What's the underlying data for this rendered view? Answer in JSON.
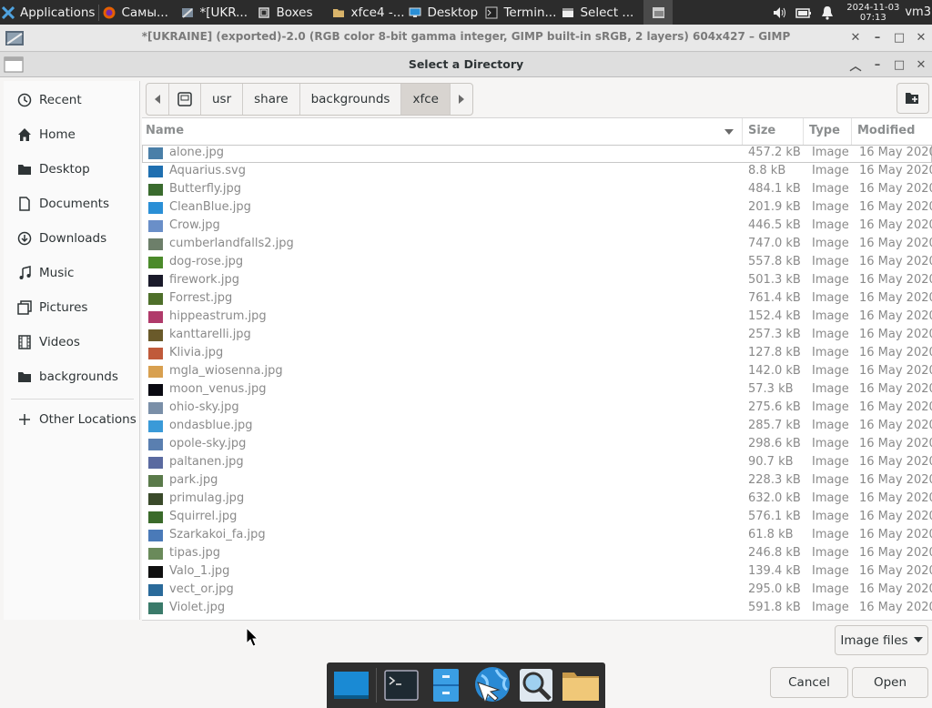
{
  "taskbar": {
    "apps_label": "Applications",
    "items": [
      {
        "label": "Самы...",
        "icon": "firefox-icon"
      },
      {
        "label": "*[UKR...",
        "icon": "gimp-icon"
      },
      {
        "label": "Boxes",
        "icon": "boxes-icon"
      },
      {
        "label": "xfce4 -...",
        "icon": "folder-icon"
      },
      {
        "label": "Desktop",
        "icon": "desktop-icon"
      },
      {
        "label": "Termin...",
        "icon": "terminal-icon"
      },
      {
        "label": "Select ...",
        "icon": "dialog-icon"
      }
    ],
    "clock_date": "2024-11-03",
    "clock_time": "07:13",
    "user": "vm3"
  },
  "gimp_window": {
    "title": "*[UKRAINE] (exported)-2.0 (RGB color 8-bit gamma integer, GIMP built-in sRGB, 2 layers) 604x427 – GIMP"
  },
  "dialog": {
    "title": "Select a Directory",
    "sidebar": [
      {
        "label": "Recent",
        "icon": "clock-icon"
      },
      {
        "label": "Home",
        "icon": "home-icon"
      },
      {
        "label": "Desktop",
        "icon": "folder-icon"
      },
      {
        "label": "Documents",
        "icon": "document-icon"
      },
      {
        "label": "Downloads",
        "icon": "download-icon"
      },
      {
        "label": "Music",
        "icon": "music-icon"
      },
      {
        "label": "Pictures",
        "icon": "pictures-icon"
      },
      {
        "label": "Videos",
        "icon": "video-icon"
      },
      {
        "label": "backgrounds",
        "icon": "folder-icon"
      },
      {
        "label": "Other Locations",
        "icon": "plus-icon"
      }
    ],
    "path": [
      "usr",
      "share",
      "backgrounds",
      "xfce"
    ],
    "columns": {
      "name": "Name",
      "size": "Size",
      "type": "Type",
      "modified": "Modified"
    },
    "files": [
      {
        "name": "alone.jpg",
        "size": "457.2 kB",
        "type": "Image",
        "modified": "16 May 2020",
        "thumb": "#4a7fa8"
      },
      {
        "name": "Aquarius.svg",
        "size": "8.8 kB",
        "type": "Image",
        "modified": "16 May 2020",
        "thumb": "#1f6fb0"
      },
      {
        "name": "Butterfly.jpg",
        "size": "484.1 kB",
        "type": "Image",
        "modified": "16 May 2020",
        "thumb": "#3a6b2e"
      },
      {
        "name": "CleanBlue.jpg",
        "size": "201.9 kB",
        "type": "Image",
        "modified": "16 May 2020",
        "thumb": "#2a8fd6"
      },
      {
        "name": "Crow.jpg",
        "size": "446.5 kB",
        "type": "Image",
        "modified": "16 May 2020",
        "thumb": "#6a8fc8"
      },
      {
        "name": "cumberlandfalls2.jpg",
        "size": "747.0 kB",
        "type": "Image",
        "modified": "16 May 2020",
        "thumb": "#6d7f6a"
      },
      {
        "name": "dog-rose.jpg",
        "size": "557.8 kB",
        "type": "Image",
        "modified": "16 May 2020",
        "thumb": "#4b8a2a"
      },
      {
        "name": "firework.jpg",
        "size": "501.3 kB",
        "type": "Image",
        "modified": "16 May 2020",
        "thumb": "#1a1a2a"
      },
      {
        "name": "Forrest.jpg",
        "size": "761.4 kB",
        "type": "Image",
        "modified": "16 May 2020",
        "thumb": "#4e6f2a"
      },
      {
        "name": "hippeastrum.jpg",
        "size": "152.4 kB",
        "type": "Image",
        "modified": "16 May 2020",
        "thumb": "#b03a6a"
      },
      {
        "name": "kanttarelli.jpg",
        "size": "257.3 kB",
        "type": "Image",
        "modified": "16 May 2020",
        "thumb": "#6a5a2a"
      },
      {
        "name": "Klivia.jpg",
        "size": "127.8 kB",
        "type": "Image",
        "modified": "16 May 2020",
        "thumb": "#c05a3a"
      },
      {
        "name": "mgla_wiosenna.jpg",
        "size": "142.0 kB",
        "type": "Image",
        "modified": "16 May 2020",
        "thumb": "#d8a050"
      },
      {
        "name": "moon_venus.jpg",
        "size": "57.3 kB",
        "type": "Image",
        "modified": "16 May 2020",
        "thumb": "#0a0a12"
      },
      {
        "name": "ohio-sky.jpg",
        "size": "275.6 kB",
        "type": "Image",
        "modified": "16 May 2020",
        "thumb": "#7a8fa8"
      },
      {
        "name": "ondasblue.jpg",
        "size": "285.7 kB",
        "type": "Image",
        "modified": "16 May 2020",
        "thumb": "#3a9ad8"
      },
      {
        "name": "opole-sky.jpg",
        "size": "298.6 kB",
        "type": "Image",
        "modified": "16 May 2020",
        "thumb": "#5a7fb0"
      },
      {
        "name": "paltanen.jpg",
        "size": "90.7 kB",
        "type": "Image",
        "modified": "16 May 2020",
        "thumb": "#5a6aa0"
      },
      {
        "name": "park.jpg",
        "size": "228.3 kB",
        "type": "Image",
        "modified": "16 May 2020",
        "thumb": "#5a7a4a"
      },
      {
        "name": "primulag.jpg",
        "size": "632.0 kB",
        "type": "Image",
        "modified": "16 May 2020",
        "thumb": "#3a4a2a"
      },
      {
        "name": "Squirrel.jpg",
        "size": "576.1 kB",
        "type": "Image",
        "modified": "16 May 2020",
        "thumb": "#3a6a2a"
      },
      {
        "name": "Szarkakoi_fa.jpg",
        "size": "61.8 kB",
        "type": "Image",
        "modified": "16 May 2020",
        "thumb": "#4a7ab8"
      },
      {
        "name": "tipas.jpg",
        "size": "246.8 kB",
        "type": "Image",
        "modified": "16 May 2020",
        "thumb": "#6a8a5a"
      },
      {
        "name": "Valo_1.jpg",
        "size": "139.4 kB",
        "type": "Image",
        "modified": "16 May 2020",
        "thumb": "#101010"
      },
      {
        "name": "vect_or.jpg",
        "size": "295.0 kB",
        "type": "Image",
        "modified": "16 May 2020",
        "thumb": "#2a6a9a"
      },
      {
        "name": "Violet.jpg",
        "size": "591.8 kB",
        "type": "Image",
        "modified": "16 May 2020",
        "thumb": "#3a7a6a"
      }
    ],
    "filter_label": "Image files",
    "cancel_label": "Cancel",
    "open_label": "Open"
  },
  "dock": [
    "desktop-icon",
    "terminal-icon",
    "file-manager-icon",
    "web-browser-icon",
    "search-icon",
    "folder-icon"
  ]
}
